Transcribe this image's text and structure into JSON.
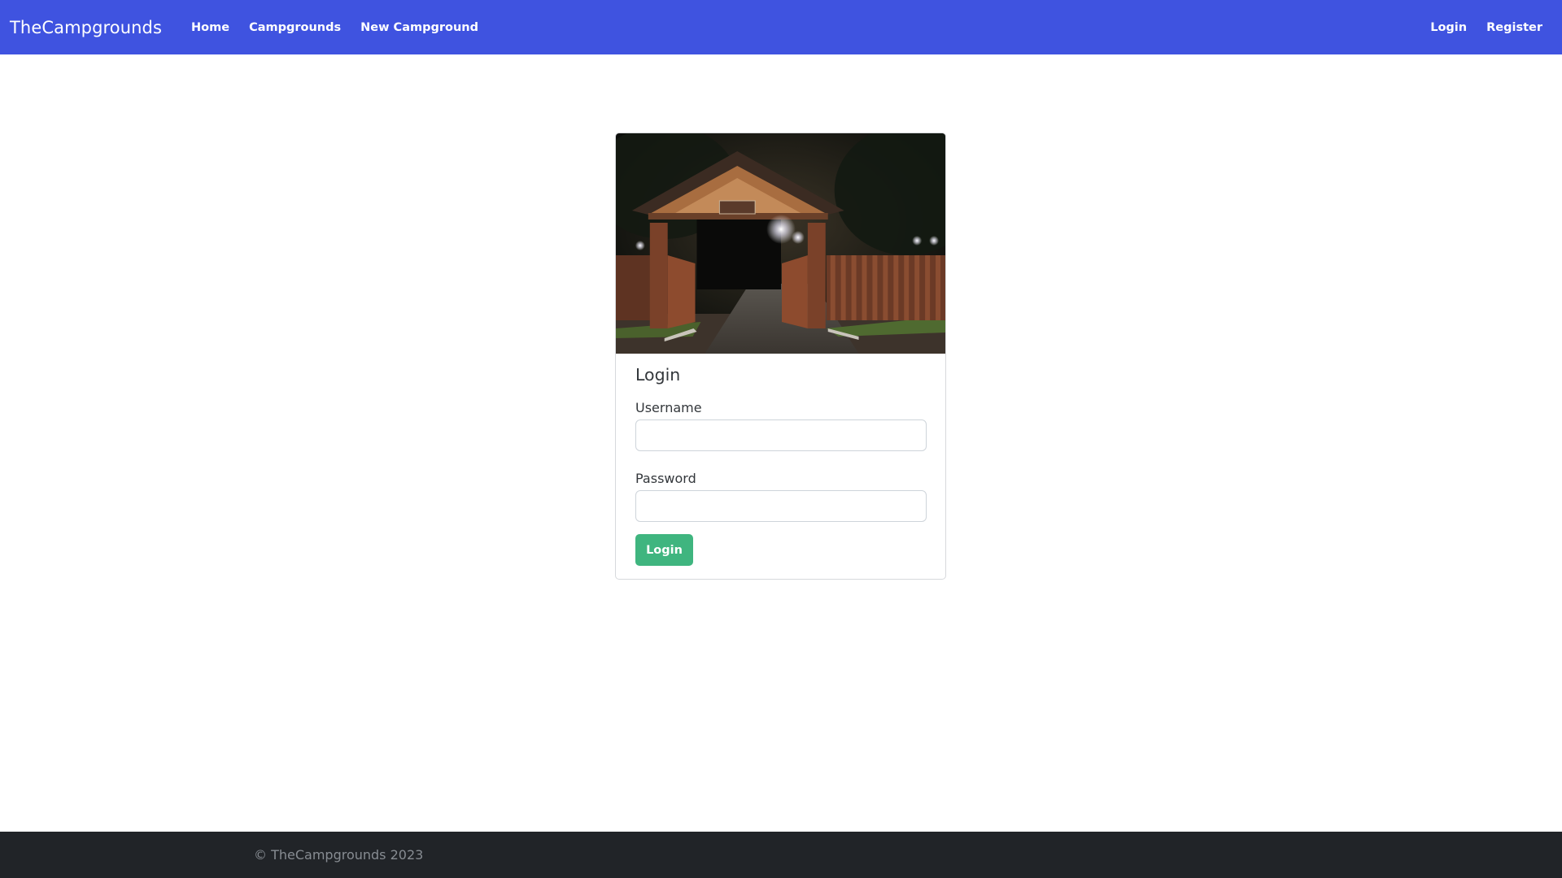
{
  "navbar": {
    "brand": "TheCampgrounds",
    "links": [
      "Home",
      "Campgrounds",
      "New Campground"
    ],
    "right_links": [
      "Login",
      "Register"
    ],
    "background_color": "#3f53e0"
  },
  "card": {
    "image_description_icon": "campground-gate-image",
    "title": "Login",
    "username_label": "Username",
    "username_value": "",
    "password_label": "Password",
    "password_value": "",
    "submit_label": "Login",
    "submit_color": "#3fb57f"
  },
  "footer": {
    "text": "© TheCampgrounds 2023",
    "background_color": "#212428"
  }
}
